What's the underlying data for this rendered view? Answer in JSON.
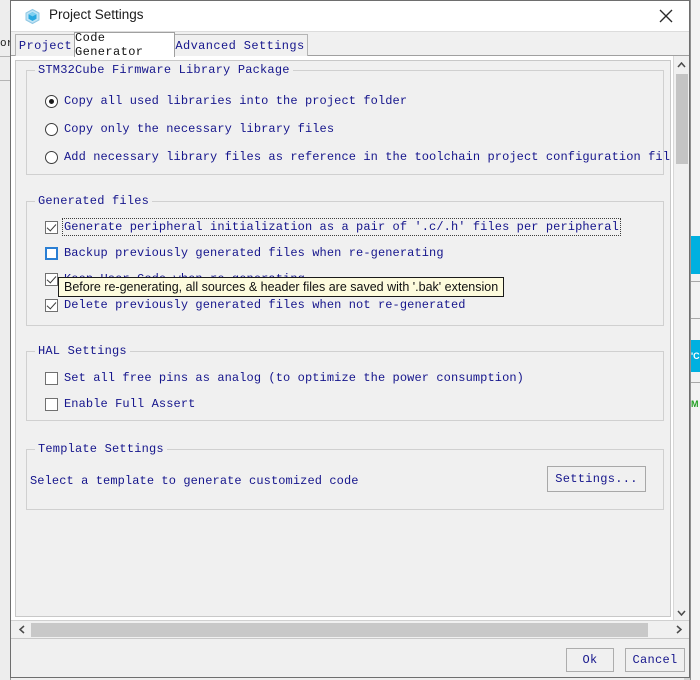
{
  "background_app": {
    "left_label": "or",
    "right_chips": [
      {
        "label": ""
      },
      {
        "label": "'C"
      },
      {
        "label": "M"
      }
    ]
  },
  "window": {
    "title": "Project Settings",
    "icon": "cube-icon",
    "close_icon": "close-icon"
  },
  "tabs": [
    {
      "label": "Project",
      "active": false
    },
    {
      "label": "Code Generator",
      "active": true
    },
    {
      "label": "Advanced Settings",
      "active": false
    }
  ],
  "groups": {
    "firmware": {
      "title": "STM32Cube Firmware Library Package",
      "options": [
        {
          "label": "Copy all used libraries into the project folder",
          "checked": true
        },
        {
          "label": "Copy only the necessary library files",
          "checked": false
        },
        {
          "label": "Add necessary library files as reference in the toolchain project configuration file",
          "checked": false
        }
      ]
    },
    "generated_files": {
      "title": "Generated files",
      "options": [
        {
          "label": "Generate peripheral initialization as a pair of '.c/.h' files per peripheral",
          "checked": true,
          "focused": true,
          "hover": false
        },
        {
          "label": "Backup previously generated files when re-generating",
          "checked": false,
          "focused": false,
          "hover": true
        },
        {
          "label": "Keep User Code when re-generating",
          "checked": true,
          "focused": false,
          "hover": false
        },
        {
          "label": "Delete previously generated files when not re-generated",
          "checked": true,
          "focused": false,
          "hover": false
        }
      ]
    },
    "hal": {
      "title": "HAL Settings",
      "options": [
        {
          "label": "Set all free pins as analog (to optimize the power consumption)",
          "checked": false
        },
        {
          "label": "Enable Full Assert",
          "checked": false
        }
      ]
    },
    "template": {
      "title": "Template Settings",
      "description": "Select a template to generate customized code",
      "settings_button": "Settings..."
    }
  },
  "tooltip": {
    "text": "Before re-generating, all sources & header files are saved with '.bak' extension"
  },
  "footer": {
    "ok_label": "Ok",
    "cancel_label": "Cancel"
  },
  "scrollbars": {
    "up_arrow": "chevron-up-icon",
    "down_arrow": "chevron-down-icon",
    "left_arrow": "chevron-left-icon",
    "right_arrow": "chevron-right-icon"
  }
}
